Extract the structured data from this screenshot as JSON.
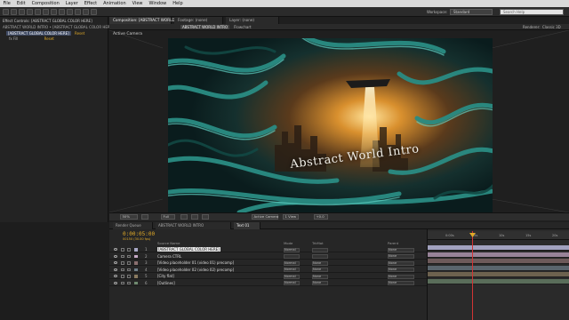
{
  "menubar": {
    "items": [
      "File",
      "Edit",
      "Composition",
      "Layer",
      "Effect",
      "Animation",
      "View",
      "Window",
      "Help"
    ],
    "workspace_label": "Workspace:",
    "workspace_value": "Standard",
    "search_placeholder": "Search Help"
  },
  "project": {
    "tab_label": "Effect Controls: [ABSTRACT GLOBAL COLOR HERE]",
    "row1": "ABSTRACT WORLD INTRO • [ABSTRACT GLOBAL COLOR HERE]",
    "row2_label": "[ABSTRACT GLOBAL COLOR HERE]",
    "row2_fx": "Reset",
    "row3": "fx  Fill",
    "row3_value": "Reset"
  },
  "viewer": {
    "tabs": [
      "Composition: [ABSTRACT WORLD INTRO]",
      "Footage: (none)",
      "Layer: (none)"
    ],
    "sub_tabs": [
      "ABSTRACT WORLD INTRO",
      "Flowchart"
    ],
    "renderer_label": "Renderer:",
    "renderer_value": "Classic 3D",
    "active_camera": "Active Camera",
    "frame_title": "Abstract World Intro",
    "controls": [
      "50%",
      "Full",
      "Active Camera",
      "1 View",
      "+0.0"
    ]
  },
  "timeline": {
    "tabs": [
      "Render Queue",
      "ABSTRACT WORLD INTRO",
      "Text 01"
    ],
    "timecode": "0:00:05:00",
    "fps_label": "00150 (30.00 fps)",
    "headers": {
      "source_name": "Source Name",
      "mode": "Mode",
      "trkmat": "TrkMat",
      "parent": "Parent"
    },
    "ruler_ticks": [
      "0:00s",
      "05s",
      "10s",
      "15s",
      "20s"
    ],
    "layers": [
      {
        "num": "1",
        "name": "[ABSTRACT GLOBAL COLOR HERE]",
        "mode": "Normal",
        "trk": "",
        "parent": "None",
        "selected": true,
        "color": "#a9a9c7"
      },
      {
        "num": "2",
        "name": "Camera CTRL",
        "mode": "",
        "trk": "",
        "parent": "None",
        "selected": false,
        "color": "#c7a9c7"
      },
      {
        "num": "3",
        "name": "[Video placeholder 01 (video 01) precomp]",
        "mode": "Normal",
        "trk": "None",
        "parent": "None",
        "selected": false,
        "color": "#8a6f6f"
      },
      {
        "num": "4",
        "name": "[Video placeholder 02 (video 02) precomp]",
        "mode": "Normal",
        "trk": "None",
        "parent": "None",
        "selected": false,
        "color": "#6f7f8a"
      },
      {
        "num": "5",
        "name": "[City flat]",
        "mode": "Normal",
        "trk": "None",
        "parent": "None",
        "selected": false,
        "color": "#8a7a5f"
      },
      {
        "num": "6",
        "name": "[Outlines]",
        "mode": "Normal",
        "trk": "None",
        "parent": "None",
        "selected": false,
        "color": "#6f8a6f"
      }
    ]
  },
  "colors": {
    "accent_timecode": "#e0a928",
    "playhead": "#d23434",
    "comp_bg": "#0e2324",
    "cable_teal": "#2a8c83"
  }
}
